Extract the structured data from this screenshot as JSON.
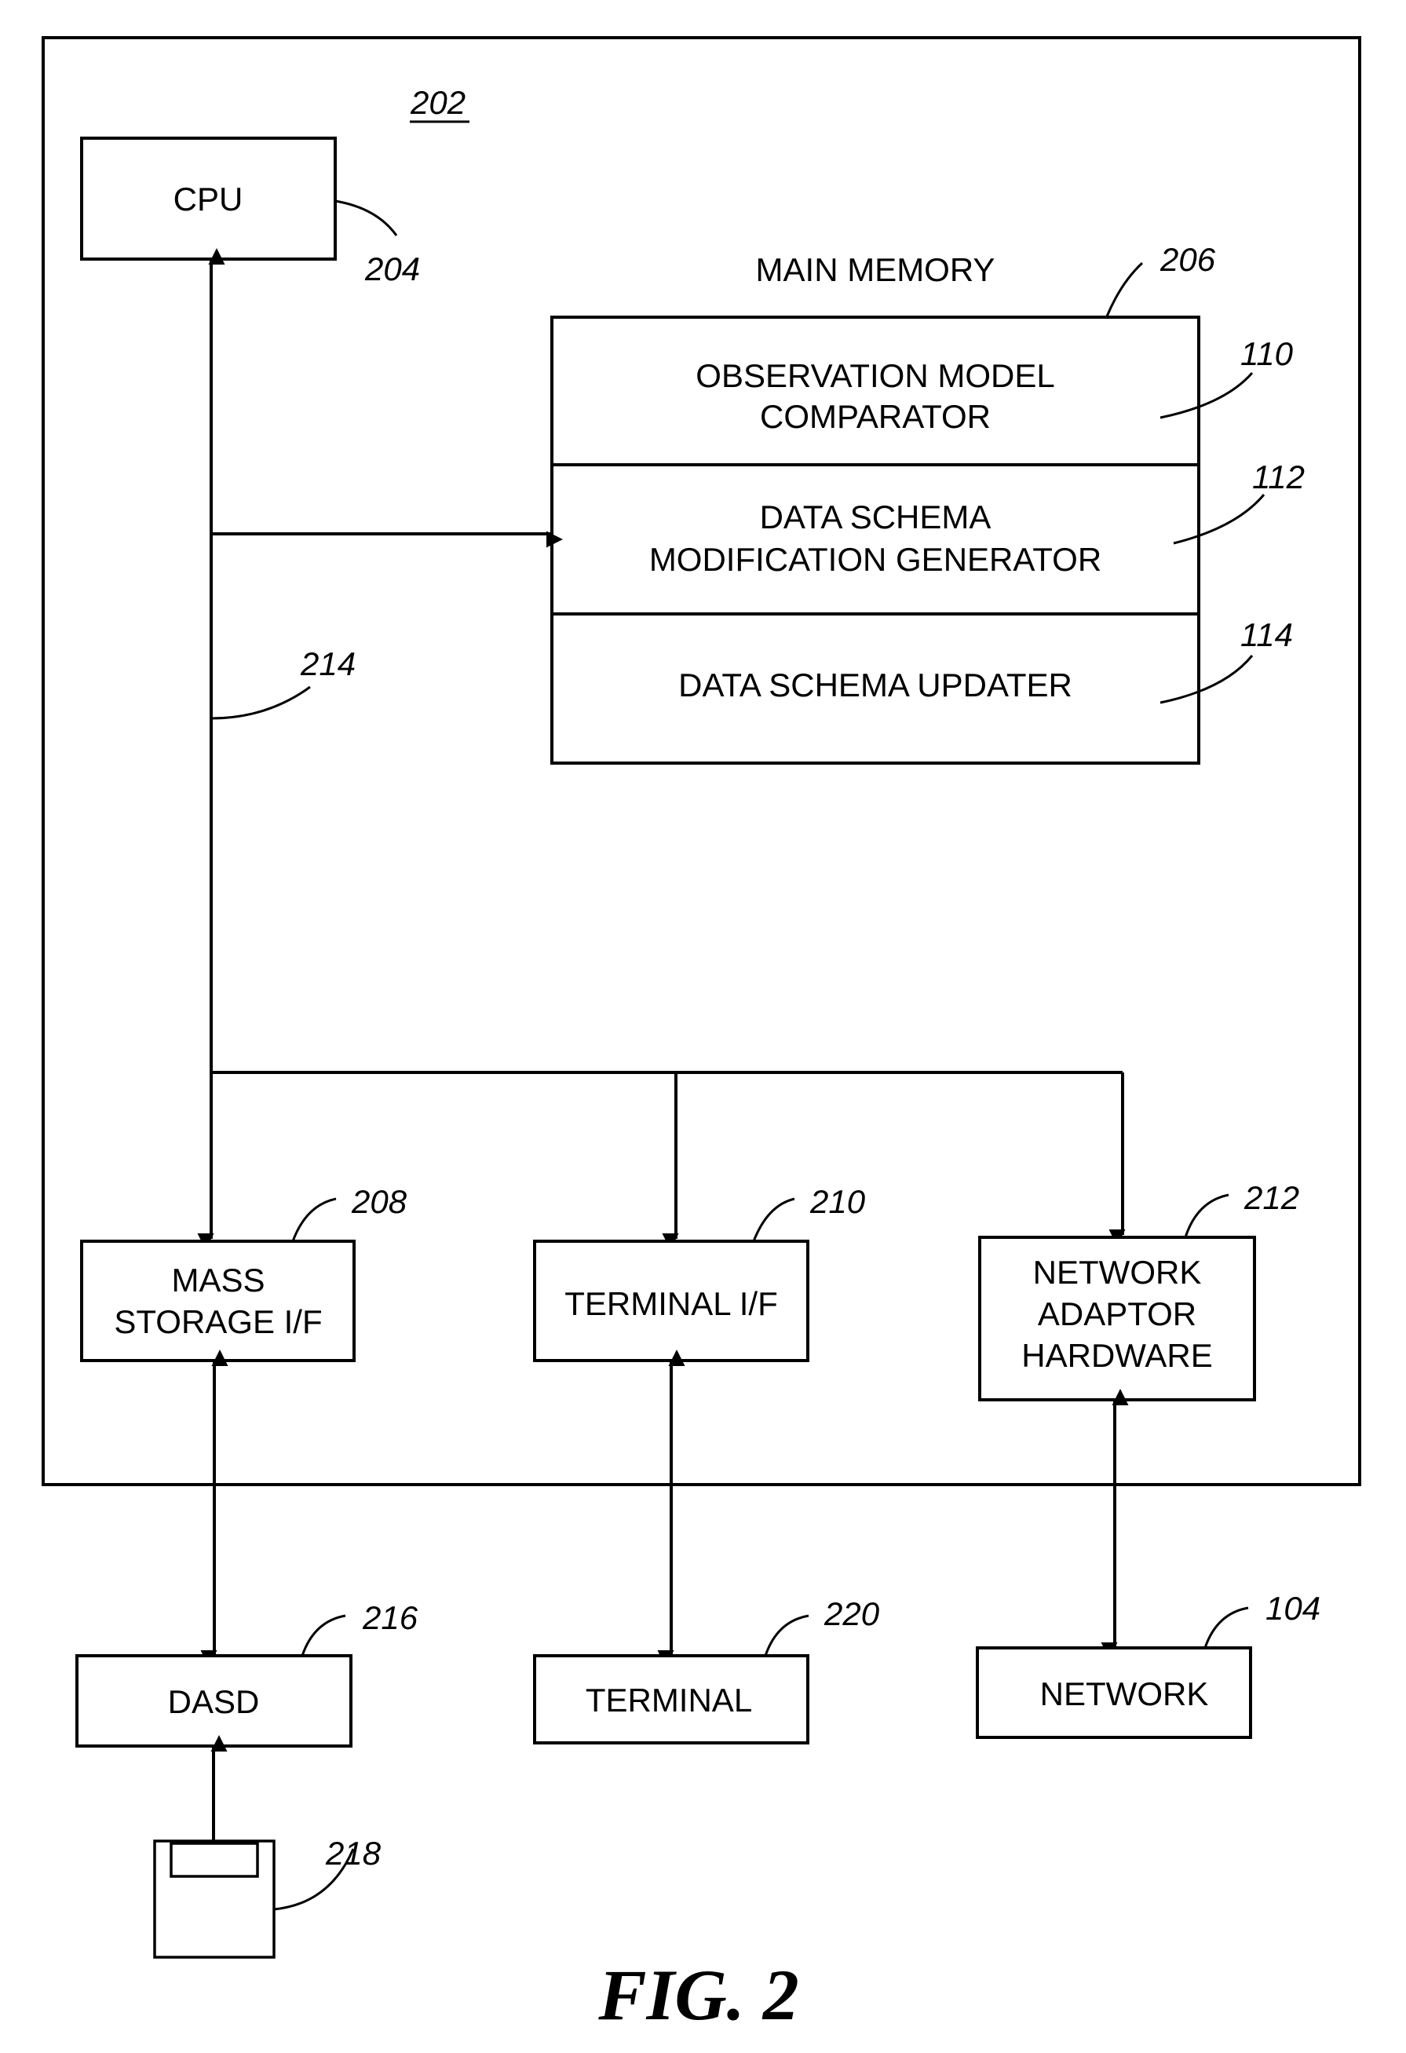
{
  "figure": {
    "caption": "FIG. 2",
    "system_ref": "202",
    "cpu": {
      "label": "CPU",
      "ref": "204"
    },
    "main_memory": {
      "title": "MAIN MEMORY",
      "ref": "206",
      "modules": [
        {
          "line1": "OBSERVATION MODEL",
          "line2": "COMPARATOR",
          "ref": "110"
        },
        {
          "line1": "DATA SCHEMA",
          "line2": "MODIFICATION GENERATOR",
          "ref": "112"
        },
        {
          "line1": "DATA SCHEMA UPDATER",
          "line2": "",
          "ref": "114"
        }
      ]
    },
    "bus_ref": "214",
    "interfaces": [
      {
        "lines": [
          "MASS",
          "STORAGE I/F"
        ],
        "ref": "208"
      },
      {
        "lines": [
          "TERMINAL I/F"
        ],
        "ref": "210"
      },
      {
        "lines": [
          "NETWORK",
          "ADAPTOR",
          "HARDWARE"
        ],
        "ref": "212"
      }
    ],
    "externals": [
      {
        "label": "DASD",
        "ref": "216"
      },
      {
        "label": "TERMINAL",
        "ref": "220"
      },
      {
        "label": "NETWORK",
        "ref": "104"
      }
    ],
    "media": {
      "ref": "218"
    }
  }
}
